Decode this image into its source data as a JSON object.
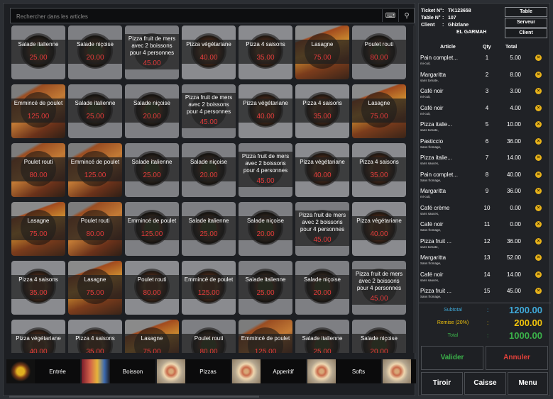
{
  "search": {
    "placeholder": "Rechercher dans les articles"
  },
  "items": [
    {
      "name": "Salade italienne",
      "price": "25.00",
      "img": "salad"
    },
    {
      "name": "Salade niçoise",
      "price": "20.00",
      "img": "salad"
    },
    {
      "name": "Pizza fruit de mers avec 2 boissons pour 4 personnes",
      "price": "45.00",
      "img": "plain",
      "long": true
    },
    {
      "name": "Pizza végétariane",
      "price": "40.00",
      "img": "pizza"
    },
    {
      "name": "Pizza 4 saisons",
      "price": "35.00",
      "img": "pizza"
    },
    {
      "name": "Lasagne",
      "price": "75.00",
      "img": "lasagne"
    },
    {
      "name": "Poulet routi",
      "price": "80.00",
      "img": "salad"
    },
    {
      "name": "Emmincé de poulet",
      "price": "125.00",
      "img": "chicken"
    },
    {
      "name": "Salade italienne",
      "price": "25.00",
      "img": "salad"
    },
    {
      "name": "Salade niçoise",
      "price": "20.00",
      "img": "salad"
    },
    {
      "name": "Pizza fruit de mers avec 2 boissons pour 4 personnes",
      "price": "45.00",
      "img": "plain",
      "long": true
    },
    {
      "name": "Pizza végétariane",
      "price": "40.00",
      "img": "pizza"
    },
    {
      "name": "Pizza 4 saisons",
      "price": "35.00",
      "img": "pizza"
    },
    {
      "name": "Lasagne",
      "price": "75.00",
      "img": "lasagne"
    },
    {
      "name": "Poulet routi",
      "price": "80.00",
      "img": "chicken"
    },
    {
      "name": "Emmincé de poulet",
      "price": "125.00",
      "img": "chicken"
    },
    {
      "name": "Salade italienne",
      "price": "25.00",
      "img": "salad"
    },
    {
      "name": "Salade niçoise",
      "price": "20.00",
      "img": "salad"
    },
    {
      "name": "Pizza fruit de mers avec 2 boissons pour 4 personnes",
      "price": "45.00",
      "img": "plain",
      "long": true
    },
    {
      "name": "Pizza végétariane",
      "price": "40.00",
      "img": "pizza"
    },
    {
      "name": "Pizza 4 saisons",
      "price": "35.00",
      "img": "pizza"
    },
    {
      "name": "Lasagne",
      "price": "75.00",
      "img": "lasagne"
    },
    {
      "name": "Poulet routi",
      "price": "80.00",
      "img": "chicken"
    },
    {
      "name": "Emmincé de poulet",
      "price": "125.00",
      "img": "salad"
    },
    {
      "name": "Salade italienne",
      "price": "25.00",
      "img": "salad"
    },
    {
      "name": "Salade niçoise",
      "price": "20.00",
      "img": "salad"
    },
    {
      "name": "Pizza fruit de mers avec 2 boissons pour 4 personnes",
      "price": "45.00",
      "img": "plain",
      "long": true
    },
    {
      "name": "Pizza végétariane",
      "price": "40.00",
      "img": "pizza"
    },
    {
      "name": "Pizza 4 saisons",
      "price": "35.00",
      "img": "pizza"
    },
    {
      "name": "Lasagne",
      "price": "75.00",
      "img": "lasagne"
    },
    {
      "name": "Poulet routi",
      "price": "80.00",
      "img": "pizza"
    },
    {
      "name": "Emmincé de poulet",
      "price": "125.00",
      "img": "pizza"
    },
    {
      "name": "Salade italienne",
      "price": "25.00",
      "img": "salad"
    },
    {
      "name": "Salade niçoise",
      "price": "20.00",
      "img": "salad"
    },
    {
      "name": "Pizza fruit de mers avec 2 boissons pour 4 personnes",
      "price": "45.00",
      "img": "plain",
      "long": true
    },
    {
      "name": "Pizza végétariane",
      "price": "40.00",
      "img": "pizza"
    },
    {
      "name": "Pizza 4 saisons",
      "price": "35.00",
      "img": "pizza"
    },
    {
      "name": "Lasagne",
      "price": "75.00",
      "img": "lasagne"
    },
    {
      "name": "Poulet routi",
      "price": "80.00",
      "img": "salad"
    },
    {
      "name": "Emmincé de poulet",
      "price": "125.00",
      "img": "chicken"
    },
    {
      "name": "Salade italienne",
      "price": "25.00",
      "img": "salad"
    },
    {
      "name": "Salade niçoise",
      "price": "20.00",
      "img": "salad"
    }
  ],
  "categories": [
    {
      "label": "Entrée",
      "thumb": "dish"
    },
    {
      "label": "Boisson",
      "thumb": "drink"
    },
    {
      "label": "Pizzas",
      "thumb": "pizza"
    },
    {
      "label": "Apperitif",
      "thumb": "pizza"
    },
    {
      "label": "Softs",
      "thumb": "pizza"
    },
    {
      "label": "",
      "thumb": "pizza"
    }
  ],
  "ticket": {
    "ticket_label": "Ticket N°",
    "ticket_value": "TK123658",
    "table_label": "Table N°",
    "table_value": "107",
    "client_label": "Client",
    "client_value": "Ghizlane",
    "client_value2": "EL GARMAH",
    "colon": ":"
  },
  "buttons": {
    "table": "Table",
    "serveur": "Serveur",
    "client": "Client"
  },
  "headers": {
    "article": "Article",
    "qty": "Qty",
    "total": "Total"
  },
  "lines": [
    {
      "article": "Pain complet...",
      "note": "mi-cuit,",
      "qty": "1",
      "total": "5.00"
    },
    {
      "article": "Margaritta",
      "note": "sans tomate,",
      "qty": "2",
      "total": "8.00"
    },
    {
      "article": "Café noir",
      "note": "mi-cuit,",
      "qty": "3",
      "total": "3.00"
    },
    {
      "article": "Café noir",
      "note": "mi-cuit,",
      "qty": "4",
      "total": "4.00"
    },
    {
      "article": "Pizza italie...",
      "note": "sans tomate,",
      "qty": "5",
      "total": "10.00"
    },
    {
      "article": "Pasticcio",
      "note": "Sans fromage,",
      "qty": "6",
      "total": "36.00"
    },
    {
      "article": "Pizza italie...",
      "note": "sans sauces,",
      "qty": "7",
      "total": "14.00"
    },
    {
      "article": "Pain complet...",
      "note": "Sans fromage,",
      "qty": "8",
      "total": "40.00"
    },
    {
      "article": "Margaritta",
      "note": "mi-cuit,",
      "qty": "9",
      "total": "36.00"
    },
    {
      "article": "Café crème",
      "note": "sans sauces,",
      "qty": "10",
      "total": "0.00"
    },
    {
      "article": "Café noir",
      "note": "Sans fromage,",
      "qty": "11",
      "total": "0.00"
    },
    {
      "article": "Pizza fruit ...",
      "note": "sans tomate,",
      "qty": "12",
      "total": "36.00"
    },
    {
      "article": "Margaritta",
      "note": "Sans fromage,",
      "qty": "13",
      "total": "52.00"
    },
    {
      "article": "Café noir",
      "note": "sans sauces,",
      "qty": "14",
      "total": "14.00"
    },
    {
      "article": "Pizza fruit ...",
      "note": "Sans fromage,",
      "qty": "15",
      "total": "45.00"
    }
  ],
  "summary": {
    "subtotal_label": "Subtotal",
    "subtotal_value": "1200.00",
    "remise_label": "Remise (20%)",
    "remise_value": "200.00",
    "total_label": "Total",
    "total_value": "1000.00",
    "colon": ":"
  },
  "actions": {
    "valider": "Valider",
    "annuler": "Annuler",
    "tiroir": "Tiroir",
    "caisse": "Caisse",
    "menu": "Menu"
  },
  "colors": {
    "price_red": "#e33b3b",
    "subtotal_blue": "#3fa9d8",
    "remise_yellow": "#f2c40c",
    "total_green": "#3bb34a",
    "annuler_red": "#e0403a",
    "delete_yellow": "#e7b21a"
  },
  "icons": {
    "keyboard": "keyboard-icon",
    "search": "search-icon",
    "delete": "close-icon"
  }
}
